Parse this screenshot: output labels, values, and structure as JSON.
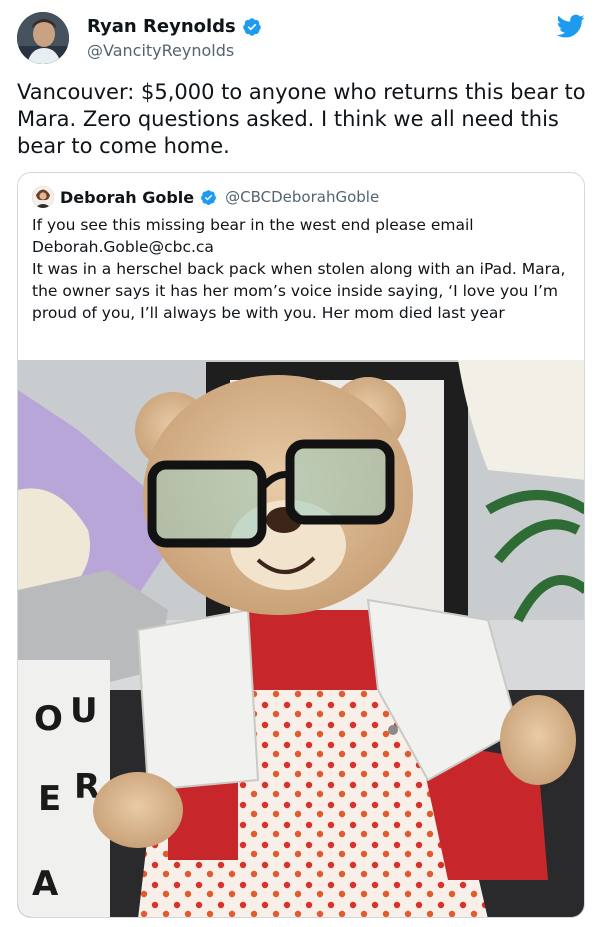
{
  "tweet": {
    "author_name": "Ryan Reynolds",
    "author_handle": "@VancityReynolds",
    "avatar_icon": "user-avatar-photo",
    "verified_icon": "verified-badge-icon",
    "platform_icon": "twitter-bird-icon",
    "text": "Vancouver: $5,000 to anyone who returns this bear to Mara. Zero questions asked. I think we all need this bear to come home."
  },
  "quoted_tweet": {
    "author_name": "Deborah Goble",
    "author_handle": "@CBCDeborahGoble",
    "verified_icon": "verified-badge-icon",
    "text": "If you see this missing bear in the west end please email Deborah.Goble@cbc.ca\nIt was in a herschel back pack when stolen along with an iPad. Mara, the owner says it has her mom’s voice inside saying, ‘I love you I’m proud of you, I’ll always be with you. Her mom died last year",
    "photo": {
      "lightbox_letters": [
        "O",
        "U",
        "E",
        "R",
        "A"
      ]
    }
  },
  "colors": {
    "twitter_blue": "#1d9bf0",
    "text_primary": "#0f1419",
    "text_secondary": "#536471",
    "border": "#cfd9de"
  }
}
